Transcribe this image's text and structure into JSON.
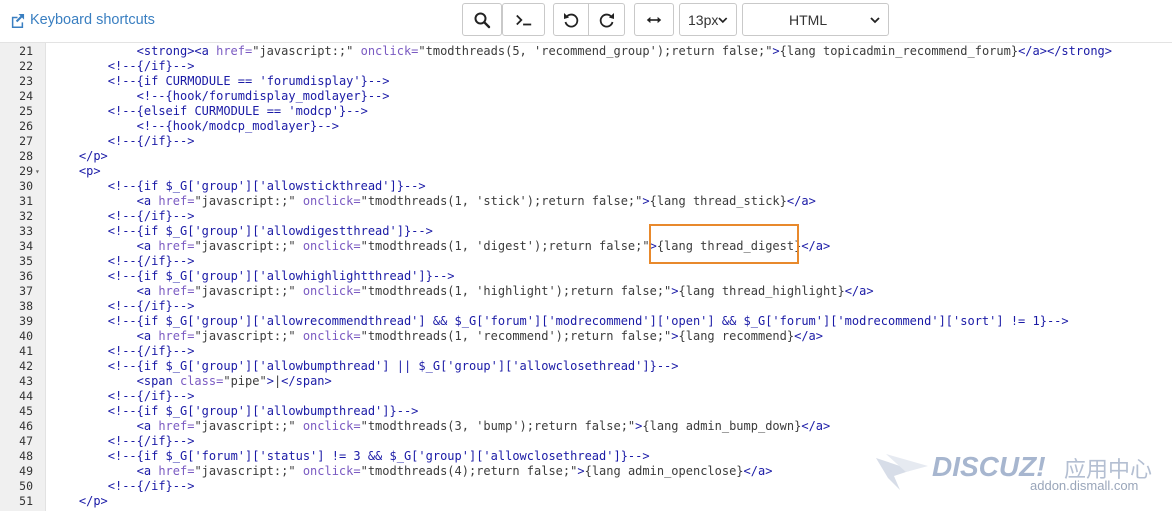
{
  "toolbar": {
    "shortcuts_label": "Keyboard shortcuts",
    "buttons": [
      {
        "icon": "search-icon"
      },
      {
        "icon": "terminal-icon"
      },
      {
        "icon": "undo-icon"
      },
      {
        "icon": "redo-icon"
      },
      {
        "icon": "wrap-icon"
      }
    ],
    "font_size": "13px",
    "language": "HTML"
  },
  "editor": {
    "lines": [
      {
        "n": "21",
        "fold": false,
        "indent": 12,
        "segs": [
          [
            "tag",
            "<strong>"
          ],
          [
            "tag",
            "<a "
          ],
          [
            "attr",
            "href="
          ],
          [
            "str",
            "\"javascript:;\" "
          ],
          [
            "attr",
            "onclick="
          ],
          [
            "str",
            "\"tmodthreads(5, 'recommend_group');return false;\""
          ],
          [
            "tag",
            ">"
          ],
          [
            "str",
            "{lang topicadmin_recommend_forum}"
          ],
          [
            "tag",
            "</a></strong>"
          ]
        ]
      },
      {
        "n": "22",
        "fold": false,
        "indent": 8,
        "segs": [
          [
            "cmt",
            "<!--{/if}-->"
          ]
        ]
      },
      {
        "n": "23",
        "fold": false,
        "indent": 8,
        "segs": [
          [
            "cmt",
            "<!--{if CURMODULE == 'forumdisplay'}-->"
          ]
        ]
      },
      {
        "n": "24",
        "fold": false,
        "indent": 12,
        "segs": [
          [
            "cmt",
            "<!--{hook/forumdisplay_modlayer}-->"
          ]
        ]
      },
      {
        "n": "25",
        "fold": false,
        "indent": 8,
        "segs": [
          [
            "cmt",
            "<!--{elseif CURMODULE == 'modcp'}-->"
          ]
        ]
      },
      {
        "n": "26",
        "fold": false,
        "indent": 12,
        "segs": [
          [
            "cmt",
            "<!--{hook/modcp_modlayer}-->"
          ]
        ]
      },
      {
        "n": "27",
        "fold": false,
        "indent": 8,
        "segs": [
          [
            "cmt",
            "<!--{/if}-->"
          ]
        ]
      },
      {
        "n": "28",
        "fold": false,
        "indent": 4,
        "segs": [
          [
            "tag",
            "</p>"
          ]
        ]
      },
      {
        "n": "29",
        "fold": true,
        "indent": 4,
        "segs": [
          [
            "tag",
            "<p>"
          ]
        ]
      },
      {
        "n": "30",
        "fold": false,
        "indent": 8,
        "segs": [
          [
            "cmt",
            "<!--{if $_G['group']['allowstickthread']}-->"
          ]
        ]
      },
      {
        "n": "31",
        "fold": false,
        "indent": 12,
        "segs": [
          [
            "tag",
            "<a "
          ],
          [
            "attr",
            "href="
          ],
          [
            "str",
            "\"javascript:;\" "
          ],
          [
            "attr",
            "onclick="
          ],
          [
            "str",
            "\"tmodthreads(1, 'stick');return false;\""
          ],
          [
            "tag",
            ">"
          ],
          [
            "str",
            "{lang thread_stick}"
          ],
          [
            "tag",
            "</a>"
          ]
        ]
      },
      {
        "n": "32",
        "fold": false,
        "indent": 8,
        "segs": [
          [
            "cmt",
            "<!--{/if}-->"
          ]
        ]
      },
      {
        "n": "33",
        "fold": false,
        "indent": 8,
        "segs": [
          [
            "cmt",
            "<!--{if $_G['group']['allowdigestthread']}-->"
          ]
        ]
      },
      {
        "n": "34",
        "fold": false,
        "indent": 12,
        "segs": [
          [
            "tag",
            "<a "
          ],
          [
            "attr",
            "href="
          ],
          [
            "str",
            "\"javascript:;\" "
          ],
          [
            "attr",
            "onclick="
          ],
          [
            "str",
            "\"tmodthreads(1, 'digest');return false;\""
          ],
          [
            "tag",
            ">"
          ],
          [
            "str",
            "{lang thread_digest}"
          ],
          [
            "tag",
            "</a>"
          ]
        ]
      },
      {
        "n": "35",
        "fold": false,
        "indent": 8,
        "segs": [
          [
            "cmt",
            "<!--{/if}-->"
          ]
        ]
      },
      {
        "n": "36",
        "fold": false,
        "indent": 8,
        "segs": [
          [
            "cmt",
            "<!--{if $_G['group']['allowhighlightthread']}-->"
          ]
        ]
      },
      {
        "n": "37",
        "fold": false,
        "indent": 12,
        "segs": [
          [
            "tag",
            "<a "
          ],
          [
            "attr",
            "href="
          ],
          [
            "str",
            "\"javascript:;\" "
          ],
          [
            "attr",
            "onclick="
          ],
          [
            "str",
            "\"tmodthreads(1, 'highlight');return false;\""
          ],
          [
            "tag",
            ">"
          ],
          [
            "str",
            "{lang thread_highlight}"
          ],
          [
            "tag",
            "</a>"
          ]
        ]
      },
      {
        "n": "38",
        "fold": false,
        "indent": 8,
        "segs": [
          [
            "cmt",
            "<!--{/if}-->"
          ]
        ]
      },
      {
        "n": "39",
        "fold": false,
        "indent": 8,
        "segs": [
          [
            "cmt",
            "<!--{if $_G['group']['allowrecommendthread'] && $_G['forum']['modrecommend']['open'] && $_G['forum']['modrecommend']['sort'] != 1}-->"
          ]
        ]
      },
      {
        "n": "40",
        "fold": false,
        "indent": 12,
        "segs": [
          [
            "tag",
            "<a "
          ],
          [
            "attr",
            "href="
          ],
          [
            "str",
            "\"javascript:;\" "
          ],
          [
            "attr",
            "onclick="
          ],
          [
            "str",
            "\"tmodthreads(1, 'recommend');return false;\""
          ],
          [
            "tag",
            ">"
          ],
          [
            "str",
            "{lang recommend}"
          ],
          [
            "tag",
            "</a>"
          ]
        ]
      },
      {
        "n": "41",
        "fold": false,
        "indent": 8,
        "segs": [
          [
            "cmt",
            "<!--{/if}-->"
          ]
        ]
      },
      {
        "n": "42",
        "fold": false,
        "indent": 8,
        "segs": [
          [
            "cmt",
            "<!--{if $_G['group']['allowbumpthread'] || $_G['group']['allowclosethread']}-->"
          ]
        ]
      },
      {
        "n": "43",
        "fold": false,
        "indent": 12,
        "segs": [
          [
            "tag",
            "<span "
          ],
          [
            "attr",
            "class="
          ],
          [
            "str",
            "\"pipe\""
          ],
          [
            "tag",
            ">"
          ],
          [
            "str",
            "|"
          ],
          [
            "tag",
            "</span>"
          ]
        ]
      },
      {
        "n": "44",
        "fold": false,
        "indent": 8,
        "segs": [
          [
            "cmt",
            "<!--{/if}-->"
          ]
        ]
      },
      {
        "n": "45",
        "fold": false,
        "indent": 8,
        "segs": [
          [
            "cmt",
            "<!--{if $_G['group']['allowbumpthread']}-->"
          ]
        ]
      },
      {
        "n": "46",
        "fold": false,
        "indent": 12,
        "segs": [
          [
            "tag",
            "<a "
          ],
          [
            "attr",
            "href="
          ],
          [
            "str",
            "\"javascript:;\" "
          ],
          [
            "attr",
            "onclick="
          ],
          [
            "str",
            "\"tmodthreads(3, 'bump');return false;\""
          ],
          [
            "tag",
            ">"
          ],
          [
            "str",
            "{lang admin_bump_down}"
          ],
          [
            "tag",
            "</a>"
          ]
        ]
      },
      {
        "n": "47",
        "fold": false,
        "indent": 8,
        "segs": [
          [
            "cmt",
            "<!--{/if}-->"
          ]
        ]
      },
      {
        "n": "48",
        "fold": false,
        "indent": 8,
        "segs": [
          [
            "cmt",
            "<!--{if $_G['forum']['status'] != 3 && $_G['group']['allowclosethread']}-->"
          ]
        ]
      },
      {
        "n": "49",
        "fold": false,
        "indent": 12,
        "segs": [
          [
            "tag",
            "<a "
          ],
          [
            "attr",
            "href="
          ],
          [
            "str",
            "\"javascript:;\" "
          ],
          [
            "attr",
            "onclick="
          ],
          [
            "str",
            "\"tmodthreads(4);return false;\""
          ],
          [
            "tag",
            ">"
          ],
          [
            "str",
            "{lang admin_openclose}"
          ],
          [
            "tag",
            "</a>"
          ]
        ]
      },
      {
        "n": "50",
        "fold": false,
        "indent": 8,
        "segs": [
          [
            "cmt",
            "<!--{/if}-->"
          ]
        ]
      },
      {
        "n": "51",
        "fold": false,
        "indent": 4,
        "segs": [
          [
            "tag",
            "</p>"
          ]
        ]
      }
    ]
  },
  "watermark": {
    "brand": "DISCUZ!",
    "cn": "应用中心",
    "url": "addon.dismall.com"
  }
}
